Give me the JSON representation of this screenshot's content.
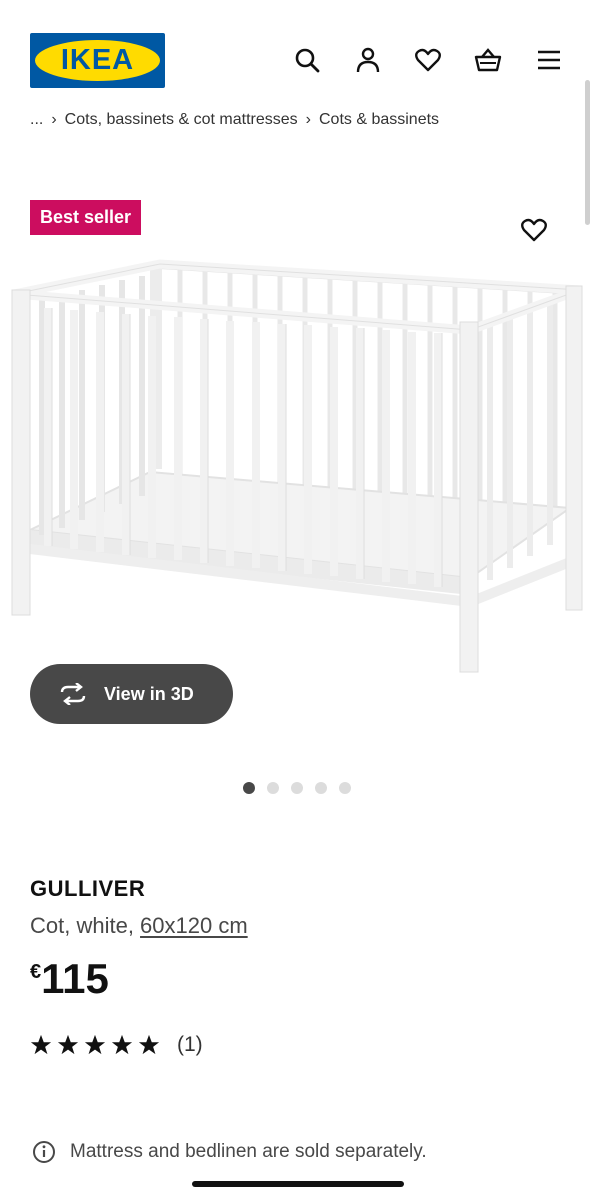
{
  "header": {
    "logo_text": "IKEA",
    "icons": [
      "search-icon",
      "profile-icon",
      "heart-icon",
      "basket-icon",
      "menu-icon"
    ]
  },
  "breadcrumb": {
    "items": [
      "...",
      "Cots, bassinets & cot mattresses",
      "Cots & bassinets"
    ],
    "separator": "›"
  },
  "product": {
    "badge": "Best seller",
    "view_3d_label": "View in 3D",
    "carousel": {
      "total": 5,
      "active": 1
    },
    "name": "GULLIVER",
    "description": "Cot, white, ",
    "dimensions": "60x120 cm",
    "currency": "€",
    "price": "115",
    "rating": {
      "stars": 5,
      "count_label": "(1)"
    },
    "info_note": "Mattress and bedlinen are sold separately."
  },
  "colors": {
    "ikea_blue": "#0058a3",
    "ikea_yellow": "#ffdb00",
    "badge_red": "#cc0d5f",
    "button_gray": "#484848"
  }
}
